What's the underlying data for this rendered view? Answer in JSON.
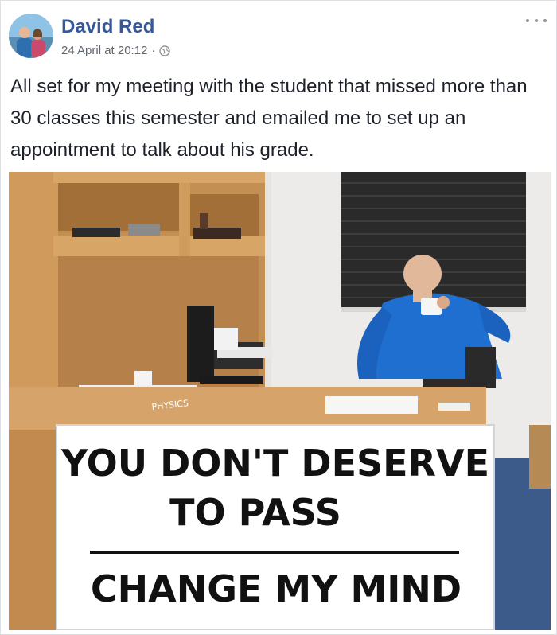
{
  "post": {
    "author": "David Red",
    "timestamp": "24 April at 20:12",
    "separator": "·",
    "audience_icon": "globe-icon",
    "more_icon": "more-options-icon",
    "text": "All set for my meeting with the student that missed more than 30 classes this semester and emailed me to set up an appointment to talk about his grade.",
    "colors": {
      "author": "#365899",
      "meta": "#606770",
      "text": "#1d2129"
    }
  },
  "photo": {
    "sign_line_1": "YOU DON'T DESERVE",
    "sign_line_2": "TO PASS",
    "sign_line_3": "CHANGE MY MIND",
    "book_spine": "PHYSICS"
  }
}
